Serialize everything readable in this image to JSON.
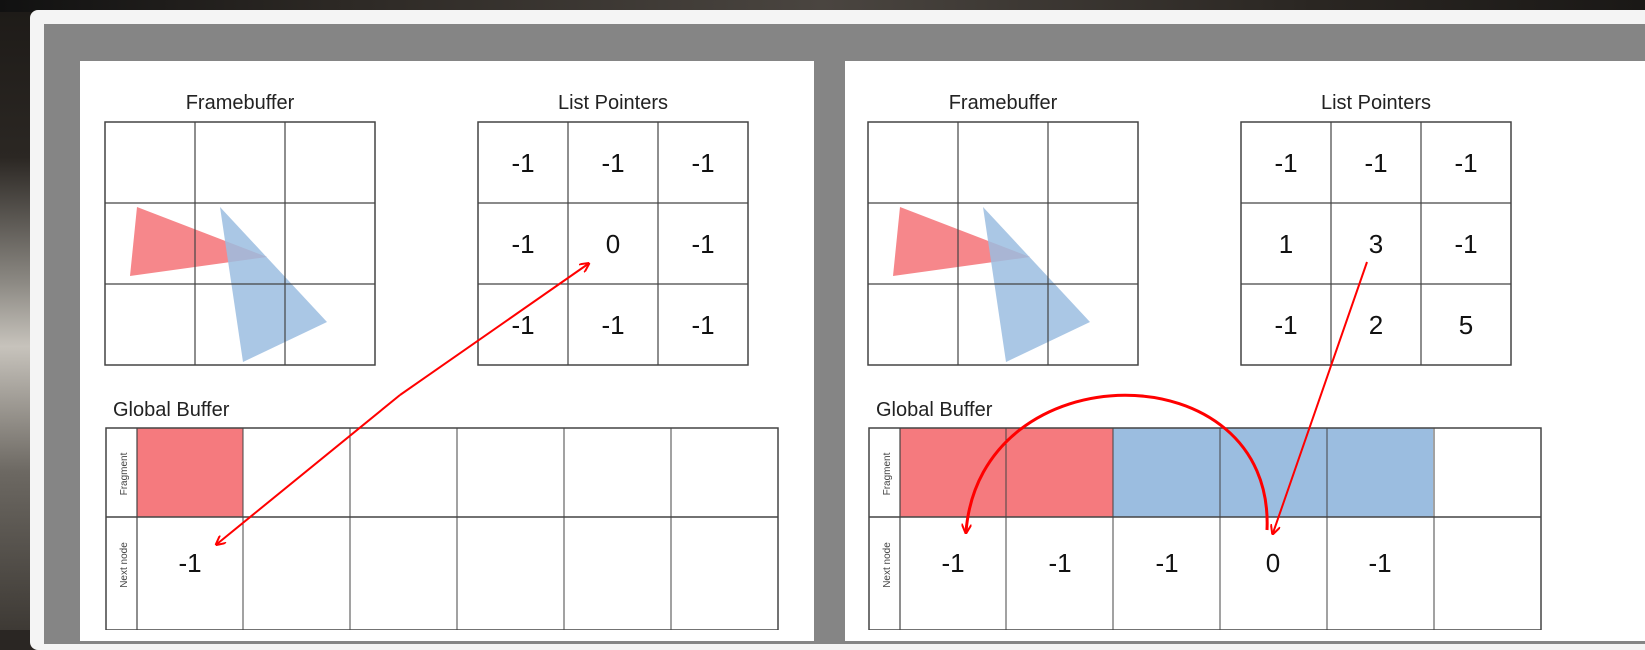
{
  "left": {
    "framebuffer_title": "Framebuffer",
    "list_pointers_title": "List Pointers",
    "list_pointers": [
      "-1",
      "-1",
      "-1",
      "-1",
      "0",
      "-1",
      "-1",
      "-1",
      "-1"
    ],
    "global_buffer_title": "Global Buffer",
    "row_label_fragment": "Fragment",
    "row_label_next": "Next node",
    "next_nodes": [
      "-1",
      "",
      "",
      "",
      "",
      ""
    ]
  },
  "right": {
    "framebuffer_title": "Framebuffer",
    "list_pointers_title": "List Pointers",
    "list_pointers": [
      "-1",
      "-1",
      "-1",
      "1",
      "3",
      "-1",
      "-1",
      "2",
      "5"
    ],
    "global_buffer_title": "Global Buffer",
    "row_label_fragment": "Fragment",
    "row_label_next": "Next node",
    "next_nodes": [
      "-1",
      "-1",
      "-1",
      "0",
      "-1",
      ""
    ]
  },
  "colors": {
    "red_fill": "#f57a7e",
    "blue_fill": "#9bbde0",
    "arrow": "#ff0000",
    "grid": "#444444"
  }
}
